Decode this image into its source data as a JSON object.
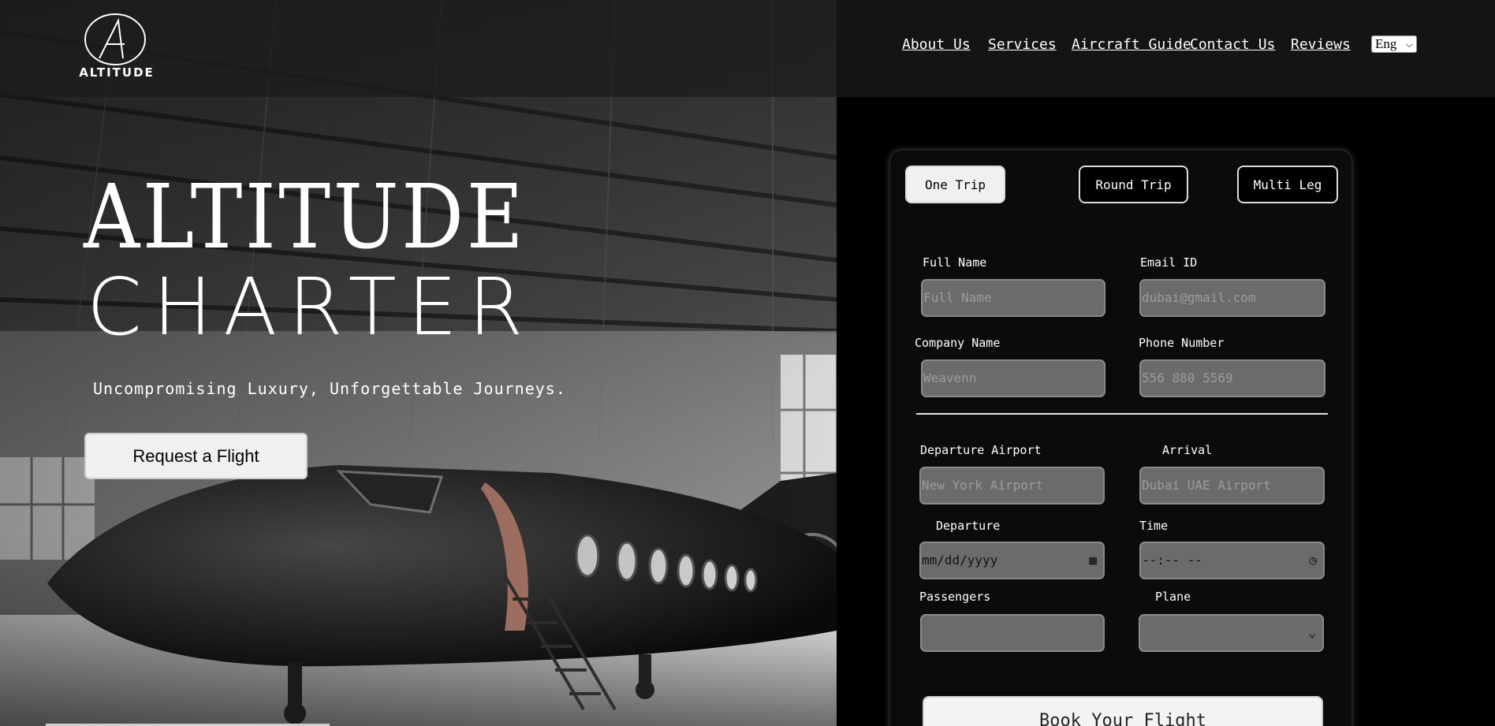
{
  "brand": {
    "name": "ALTITUDE",
    "logo_letter": "A"
  },
  "nav": {
    "items": [
      "About Us",
      "Services",
      "Aircraft Guide",
      "Contact Us",
      "Reviews"
    ],
    "language": "Eng"
  },
  "hero": {
    "title_line1": "ALTITUDE",
    "title_line2": "CHARTER",
    "tagline": "Uncompromising Luxury, Unforgettable Journeys.",
    "cta": "Request a Flight"
  },
  "booking": {
    "tabs": [
      {
        "label": "One Trip",
        "active": true
      },
      {
        "label": "Round Trip",
        "active": false
      },
      {
        "label": "Multi Leg",
        "active": false
      }
    ],
    "full_name": {
      "label": "Full Name",
      "placeholder": "Full Name"
    },
    "email": {
      "label": "Email ID",
      "placeholder": "dubai@gmail.com"
    },
    "company": {
      "label": "Company Name",
      "placeholder": "Weavenn"
    },
    "phone": {
      "label": "Phone Number",
      "placeholder": "556 880 5569"
    },
    "departure_airport": {
      "label": "Departure Airport",
      "placeholder": "New York Airport"
    },
    "arrival": {
      "label": "Arrival",
      "placeholder": "Dubai UAE Airport"
    },
    "departure_date": {
      "label": "Departure",
      "placeholder": "mm/dd/yyyy"
    },
    "time": {
      "label": "Time",
      "placeholder": "--:-- --"
    },
    "passengers": {
      "label": "Passengers",
      "value": ""
    },
    "plane": {
      "label": "Plane",
      "value": ""
    },
    "submit": "Book Your Flight"
  }
}
